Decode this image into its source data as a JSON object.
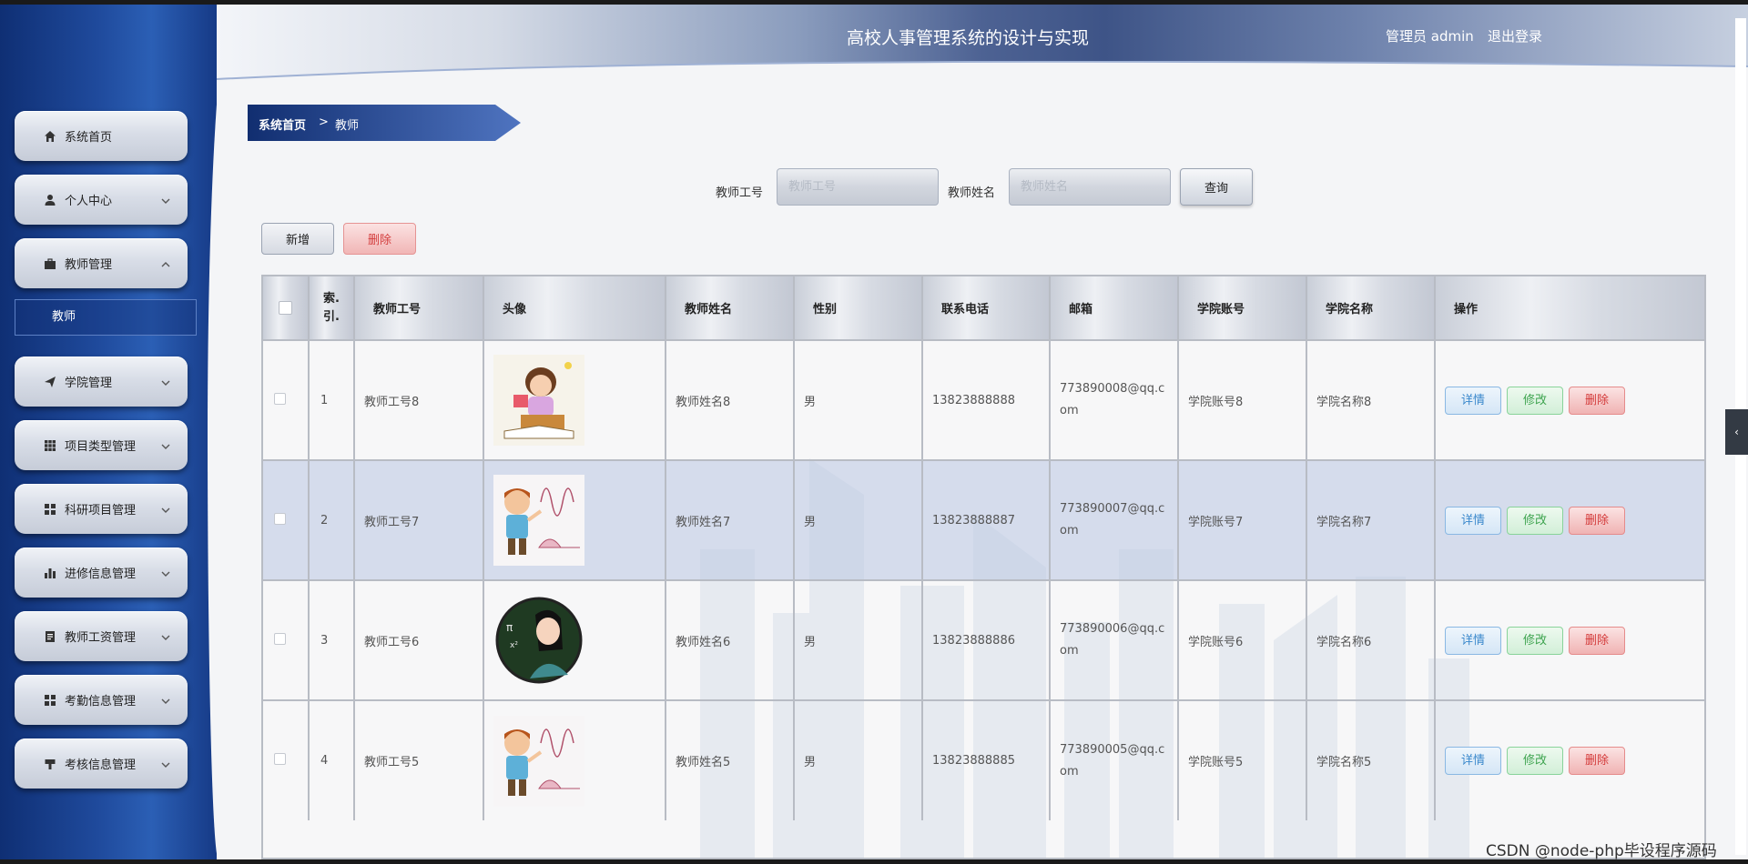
{
  "header": {
    "title": "高校人事管理系统的设计与实现",
    "user": "管理员 admin",
    "logout": "退出登录"
  },
  "sidebar": {
    "items": [
      {
        "label": "系统首页",
        "icon": "home-icon",
        "chevron": ""
      },
      {
        "label": "个人中心",
        "icon": "user-icon",
        "chevron": "down"
      },
      {
        "label": "教师管理",
        "icon": "briefcase-icon",
        "chevron": "up"
      },
      {
        "label": "学院管理",
        "icon": "send-icon",
        "chevron": "down"
      },
      {
        "label": "项目类型管理",
        "icon": "grid-icon",
        "chevron": "down"
      },
      {
        "label": "科研项目管理",
        "icon": "apps-icon",
        "chevron": "down"
      },
      {
        "label": "进修信息管理",
        "icon": "bar-chart-icon",
        "chevron": "down"
      },
      {
        "label": "教师工资管理",
        "icon": "document-icon",
        "chevron": "down"
      },
      {
        "label": "考勤信息管理",
        "icon": "apps-icon",
        "chevron": "down"
      },
      {
        "label": "考核信息管理",
        "icon": "stamp-icon",
        "chevron": "down"
      }
    ],
    "sub_item": "教师"
  },
  "breadcrumb": {
    "home": "系统首页",
    "separator": ">",
    "current": "教师"
  },
  "search": {
    "id_label": "教师工号",
    "id_placeholder": "教师工号",
    "name_label": "教师姓名",
    "name_placeholder": "教师姓名",
    "query": "查询"
  },
  "actions": {
    "add": "新增",
    "delete": "删除"
  },
  "table": {
    "columns": [
      "",
      "索引",
      "教师工号",
      "头像",
      "教师姓名",
      "性别",
      "联系电话",
      "邮箱",
      "学院账号",
      "学院名称",
      "操作"
    ],
    "index_header_l1": "索.",
    "index_header_l2": "引.",
    "rows": [
      {
        "index": "1",
        "id": "教师工号8",
        "avatar": "teacher-reading-avatar",
        "name": "教师姓名8",
        "gender": "男",
        "phone": "13823888888",
        "email": "773890008@qq.com",
        "college_account": "学院账号8",
        "college_name": "学院名称8",
        "highlighted": false
      },
      {
        "index": "2",
        "id": "教师工号7",
        "avatar": "teacher-math-avatar",
        "name": "教师姓名7",
        "gender": "男",
        "phone": "13823888887",
        "email": "773890007@qq.com",
        "college_account": "学院账号7",
        "college_name": "学院名称7",
        "highlighted": true
      },
      {
        "index": "3",
        "id": "教师工号6",
        "avatar": "teacher-chalkboard-avatar",
        "name": "教师姓名6",
        "gender": "男",
        "phone": "13823888886",
        "email": "773890006@qq.com",
        "college_account": "学院账号6",
        "college_name": "学院名称6",
        "highlighted": false
      },
      {
        "index": "4",
        "id": "教师工号5",
        "avatar": "teacher-math-avatar",
        "name": "教师姓名5",
        "gender": "男",
        "phone": "13823888885",
        "email": "773890005@qq.com",
        "college_account": "学院账号5",
        "college_name": "学院名称5",
        "highlighted": false
      }
    ],
    "row_actions": {
      "detail": "详情",
      "edit": "修改",
      "delete": "删除"
    }
  },
  "watermark": "CSDN @node-php毕设程序源码",
  "colors": {
    "sidebar": "#1f4a9c",
    "header_accent": "#4d6293",
    "detail": "#3a88cc",
    "edit": "#3ea44f",
    "delete": "#d43a3a"
  }
}
